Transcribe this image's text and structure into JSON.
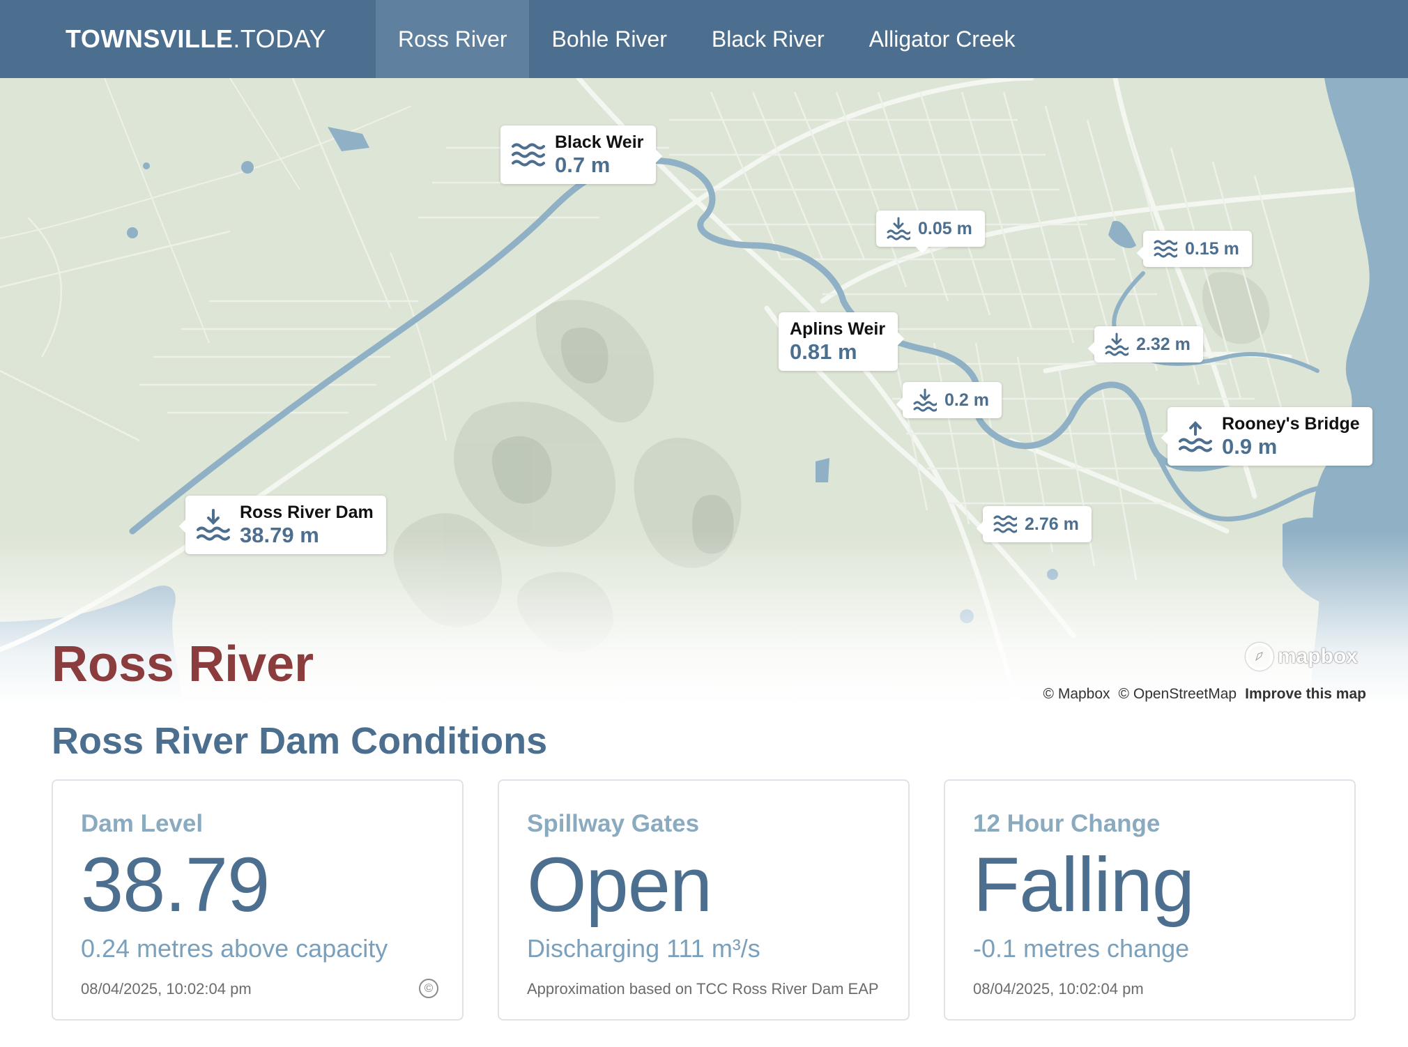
{
  "brand": {
    "bold": "TOWNSVILLE",
    "light": ".TODAY"
  },
  "nav": {
    "items": [
      {
        "label": "Ross River",
        "active": true
      },
      {
        "label": "Bohle River",
        "active": false
      },
      {
        "label": "Black River",
        "active": false
      },
      {
        "label": "Alligator Creek",
        "active": false
      }
    ]
  },
  "map": {
    "markers": [
      {
        "name": "Black Weir",
        "value": "0.7 m",
        "icon": "waves-icon"
      },
      {
        "name": "",
        "value": "0.05 m",
        "icon": "water-level-down-icon"
      },
      {
        "name": "",
        "value": "0.15 m",
        "icon": "waves-icon"
      },
      {
        "name": "Aplins Weir",
        "value": "0.81 m",
        "icon": "waves-icon"
      },
      {
        "name": "",
        "value": "2.32 m",
        "icon": "water-level-down-icon"
      },
      {
        "name": "",
        "value": "0.2 m",
        "icon": "water-level-down-icon"
      },
      {
        "name": "Rooney's Bridge",
        "value": "0.9 m",
        "icon": "water-level-up-icon"
      },
      {
        "name": "",
        "value": "2.76 m",
        "icon": "waves-icon"
      },
      {
        "name": "Ross River Dam",
        "value": "38.79 m",
        "icon": "water-level-down-icon"
      }
    ],
    "logo": "mapbox",
    "attribution": {
      "mapbox": "© Mapbox",
      "osm": "© OpenStreetMap",
      "improve": "Improve this map"
    }
  },
  "page_title": "Ross River",
  "section_title": "Ross River Dam Conditions",
  "cards": [
    {
      "label": "Dam Level",
      "value": "38.79",
      "sub": "0.24 metres above capacity",
      "foot": "08/04/2025, 10:02:04 pm",
      "badge": "©"
    },
    {
      "label": "Spillway Gates",
      "value": "Open",
      "sub": "Discharging 111 m³/s",
      "foot": "Approximation based on TCC Ross River Dam EAP"
    },
    {
      "label": "12 Hour Change",
      "value": "Falling",
      "sub": "-0.1 metres change",
      "foot": "08/04/2025, 10:02:04 pm"
    }
  ],
  "colors": {
    "header": "#4d6f8f",
    "nav_active": "#5f809f",
    "title": "#8b3d3d",
    "water": "#8fb0c5",
    "land": "#dde5d6"
  }
}
